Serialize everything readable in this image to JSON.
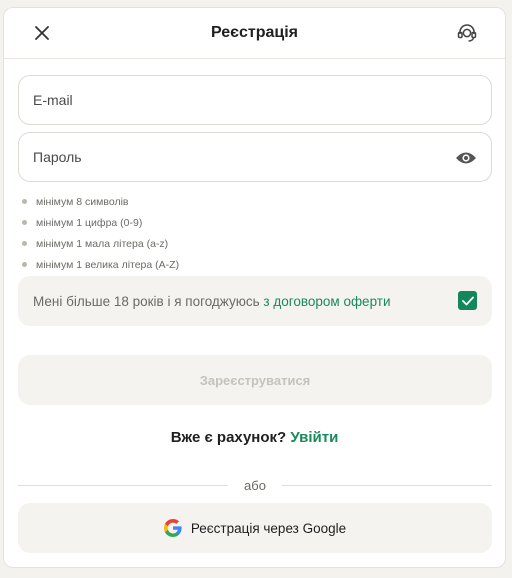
{
  "header": {
    "title": "Реєстрація",
    "close_icon": "close-icon",
    "support_icon": "support-headset-icon"
  },
  "form": {
    "email_placeholder": "E-mail",
    "password_placeholder": "Пароль",
    "password_toggle_icon": "eye-icon",
    "rules": [
      "мінімум 8 символів",
      "мінімум 1 цифра (0-9)",
      "мінімум 1 мала літера (a-z)",
      "мінімум 1 велика літера (A-Z)"
    ],
    "agree_text": "Мені більше 18 років і я погоджуюсь",
    "agree_link": "з договором оферти",
    "agree_checked": true,
    "submit_label": "Зареєструватися"
  },
  "login": {
    "question": "Вже є рахунок?",
    "link": "Увійти"
  },
  "divider_text": "або",
  "google": {
    "label": "Реєстрація через Google",
    "icon": "google-icon"
  },
  "colors": {
    "accent": "#14875a",
    "link": "#1a8a5a",
    "disabled_text": "#c5c3bb",
    "muted_bg": "#f4f3ef"
  }
}
